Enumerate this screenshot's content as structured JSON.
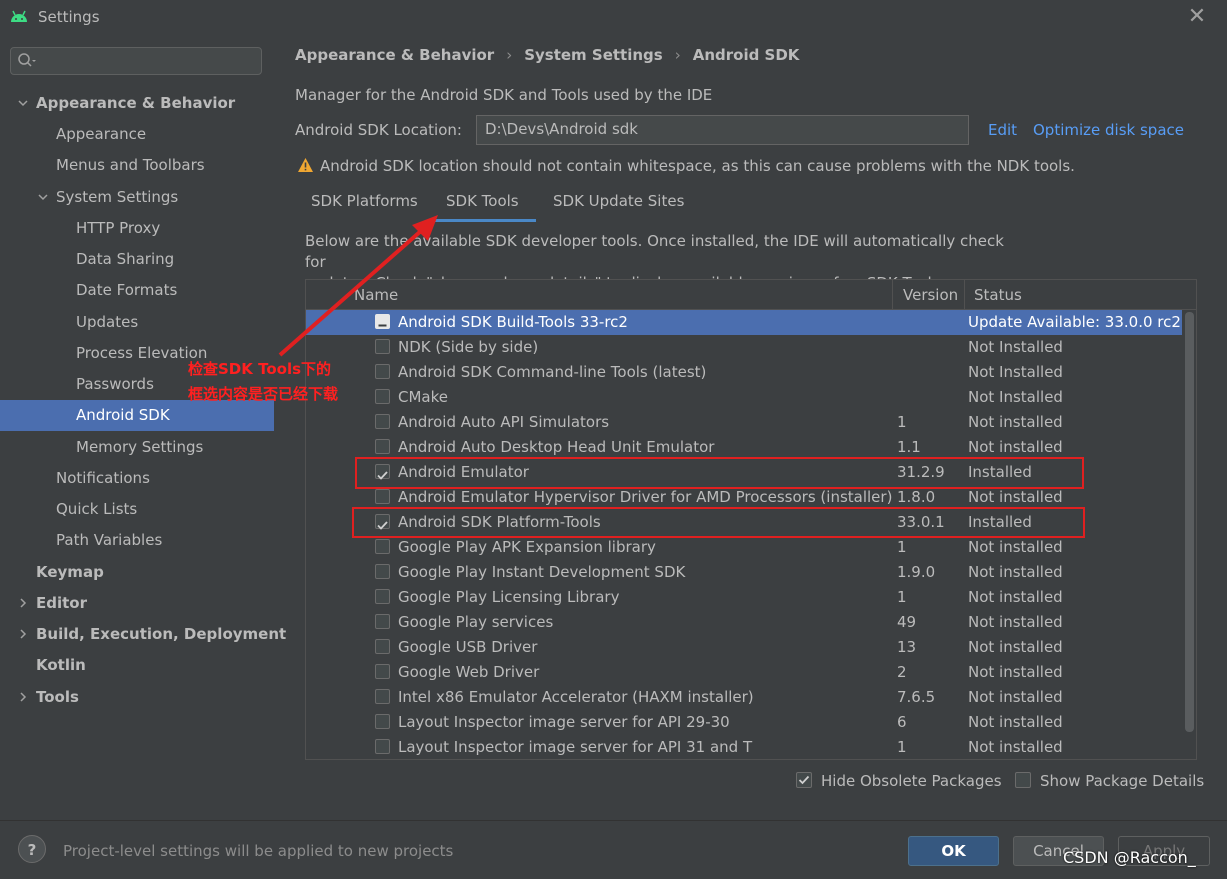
{
  "window": {
    "title": "Settings"
  },
  "search": {
    "placeholder": ""
  },
  "sidebar": {
    "items": [
      {
        "label": "Appearance & Behavior"
      },
      {
        "label": "Appearance"
      },
      {
        "label": "Menus and Toolbars"
      },
      {
        "label": "System Settings"
      },
      {
        "label": "HTTP Proxy"
      },
      {
        "label": "Data Sharing"
      },
      {
        "label": "Date Formats"
      },
      {
        "label": "Updates"
      },
      {
        "label": "Process Elevation"
      },
      {
        "label": "Passwords"
      },
      {
        "label": "Android SDK"
      },
      {
        "label": "Memory Settings"
      },
      {
        "label": "Notifications"
      },
      {
        "label": "Quick Lists"
      },
      {
        "label": "Path Variables"
      },
      {
        "label": "Keymap"
      },
      {
        "label": "Editor"
      },
      {
        "label": "Build, Execution, Deployment"
      },
      {
        "label": "Kotlin"
      },
      {
        "label": "Tools"
      }
    ]
  },
  "breadcrumb": [
    "Appearance & Behavior",
    "System Settings",
    "Android SDK"
  ],
  "main": {
    "description": "Manager for the Android SDK and Tools used by the IDE",
    "location_label": "Android SDK Location:",
    "location_value": "D:\\Devs\\Android sdk",
    "edit_link": "Edit",
    "optimize_link": "Optimize disk space",
    "warning": "Android SDK location should not contain whitespace, as this can cause problems with the NDK tools.",
    "tabs": [
      "SDK Platforms",
      "SDK Tools",
      "SDK Update Sites"
    ],
    "help_text_1": "Below are the available SDK developer tools. Once installed, the IDE will automatically check for",
    "help_text_2": "updates. Check \"show package details\" to display available versions of an SDK Tool."
  },
  "table": {
    "headers": {
      "name": "Name",
      "version": "Version",
      "status": "Status"
    },
    "rows": [
      {
        "name": "Android SDK Build-Tools 33-rc2",
        "version": "",
        "status": "Update Available: 33.0.0 rc2",
        "state": "partial"
      },
      {
        "name": "NDK (Side by side)",
        "version": "",
        "status": "Not Installed",
        "state": "unchecked"
      },
      {
        "name": "Android SDK Command-line Tools (latest)",
        "version": "",
        "status": "Not Installed",
        "state": "unchecked"
      },
      {
        "name": "CMake",
        "version": "",
        "status": "Not Installed",
        "state": "unchecked"
      },
      {
        "name": "Android Auto API Simulators",
        "version": "1",
        "status": "Not installed",
        "state": "unchecked"
      },
      {
        "name": "Android Auto Desktop Head Unit Emulator",
        "version": "1.1",
        "status": "Not installed",
        "state": "unchecked"
      },
      {
        "name": "Android Emulator",
        "version": "31.2.9",
        "status": "Installed",
        "state": "checked"
      },
      {
        "name": "Android Emulator Hypervisor Driver for AMD Processors (installer)",
        "version": "1.8.0",
        "status": "Not installed",
        "state": "unchecked"
      },
      {
        "name": "Android SDK Platform-Tools",
        "version": "33.0.1",
        "status": "Installed",
        "state": "checked"
      },
      {
        "name": "Google Play APK Expansion library",
        "version": "1",
        "status": "Not installed",
        "state": "unchecked"
      },
      {
        "name": "Google Play Instant Development SDK",
        "version": "1.9.0",
        "status": "Not installed",
        "state": "unchecked"
      },
      {
        "name": "Google Play Licensing Library",
        "version": "1",
        "status": "Not installed",
        "state": "unchecked"
      },
      {
        "name": "Google Play services",
        "version": "49",
        "status": "Not installed",
        "state": "unchecked"
      },
      {
        "name": "Google USB Driver",
        "version": "13",
        "status": "Not installed",
        "state": "unchecked"
      },
      {
        "name": "Google Web Driver",
        "version": "2",
        "status": "Not installed",
        "state": "unchecked"
      },
      {
        "name": "Intel x86 Emulator Accelerator (HAXM installer)",
        "version": "7.6.5",
        "status": "Not installed",
        "state": "unchecked"
      },
      {
        "name": "Layout Inspector image server for API 29-30",
        "version": "6",
        "status": "Not installed",
        "state": "unchecked"
      },
      {
        "name": "Layout Inspector image server for API 31 and T",
        "version": "1",
        "status": "Not installed",
        "state": "unchecked"
      }
    ]
  },
  "options": {
    "hide_obsolete": "Hide Obsolete Packages",
    "show_details": "Show Package Details"
  },
  "footer": {
    "help": "?",
    "text": "Project-level settings will be applied to new projects",
    "ok": "OK",
    "cancel": "Cancel",
    "apply": "Apply"
  },
  "annotation": {
    "line1": "检查SDK Tools下的",
    "line2": "框选内容是否已经下载"
  },
  "watermark": "CSDN @Raccon_",
  "colors": {
    "background": "#3c3f41",
    "selection": "#4b6eaf",
    "link": "#589df6",
    "annotation": "#e02020",
    "android_green": "#3ddc84"
  }
}
